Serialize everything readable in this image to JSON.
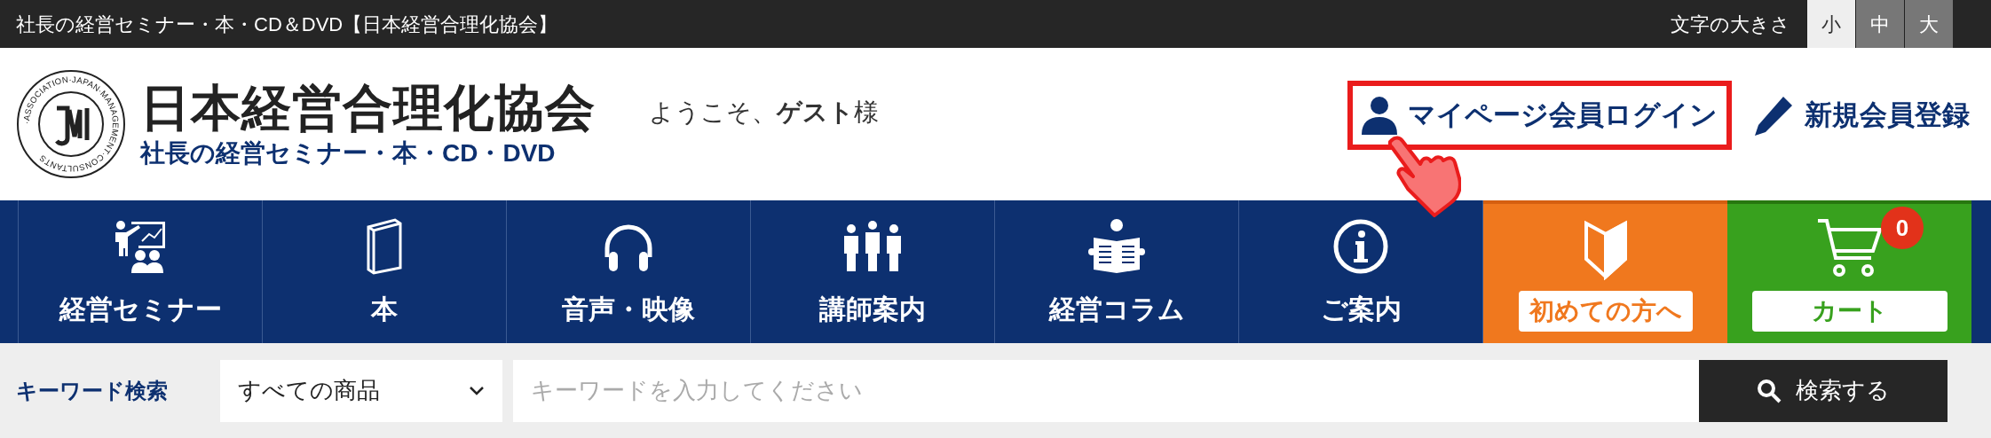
{
  "top_bar": {
    "title": "社長の経営セミナー・本・CD＆DVD【日本経営合理化協会】",
    "font_size_label": "文字の大きさ",
    "font_sizes": [
      {
        "label": "小",
        "selected": true
      },
      {
        "label": "中",
        "selected": false
      },
      {
        "label": "大",
        "selected": false
      }
    ]
  },
  "header": {
    "logo_ring_text": "·ASSOCIATION·JAPAN·MANAGEMENT·CONSULTANTS",
    "logo_title": "日本経営合理化協会",
    "logo_subtitle": "社長の経営セミナー・本・CD・DVD",
    "welcome": "ようこそ、**ゲスト**様",
    "login_button": "マイページ会員ログイン",
    "register_link": "新規会員登録"
  },
  "nav": [
    {
      "kind": "standard",
      "label": "経営セミナー"
    },
    {
      "kind": "standard",
      "label": "本"
    },
    {
      "kind": "standard",
      "label": "音声・映像"
    },
    {
      "kind": "standard",
      "label": "講師案内"
    },
    {
      "kind": "standard",
      "label": "経営コラム"
    },
    {
      "kind": "standard",
      "label": "ご案内"
    },
    {
      "kind": "beginner",
      "label": "初めての方へ"
    },
    {
      "kind": "cart",
      "label": "カート",
      "badge": "0"
    }
  ],
  "search": {
    "label": "キーワード検索",
    "category": "すべての商品",
    "placeholder": "キーワードを入力してください",
    "button": "検索する"
  }
}
